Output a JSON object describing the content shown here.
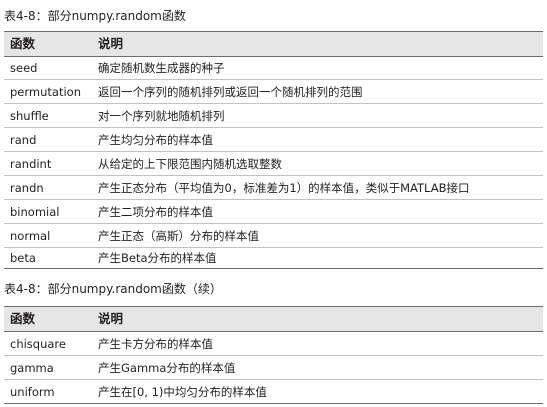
{
  "table1": {
    "caption": "表4-8：部分numpy.random函数",
    "headers": [
      "函数",
      "说明"
    ],
    "rows": [
      [
        "seed",
        "确定随机数生成器的种子"
      ],
      [
        "permutation",
        "返回一个序列的随机排列或返回一个随机排列的范围"
      ],
      [
        "shuffle",
        "对一个序列就地随机排列"
      ],
      [
        "rand",
        "产生均匀分布的样本值"
      ],
      [
        "randint",
        "从给定的上下限范围内随机选取整数"
      ],
      [
        "randn",
        "产生正态分布（平均值为0，标准差为1）的样本值，类似于MATLAB接口"
      ],
      [
        "binomial",
        "产生二项分布的样本值"
      ],
      [
        "normal",
        "产生正态（高斯）分布的样本值"
      ],
      [
        "beta",
        "产生Beta分布的样本值"
      ]
    ]
  },
  "table2": {
    "caption": "表4-8：部分numpy.random函数（续）",
    "headers": [
      "函数",
      "说明"
    ],
    "rows": [
      [
        "chisquare",
        "产生卡方分布的样本值"
      ],
      [
        "gamma",
        "产生Gamma分布的样本值"
      ],
      [
        "uniform",
        "产生在[0, 1)中均匀分布的样本值"
      ]
    ]
  }
}
